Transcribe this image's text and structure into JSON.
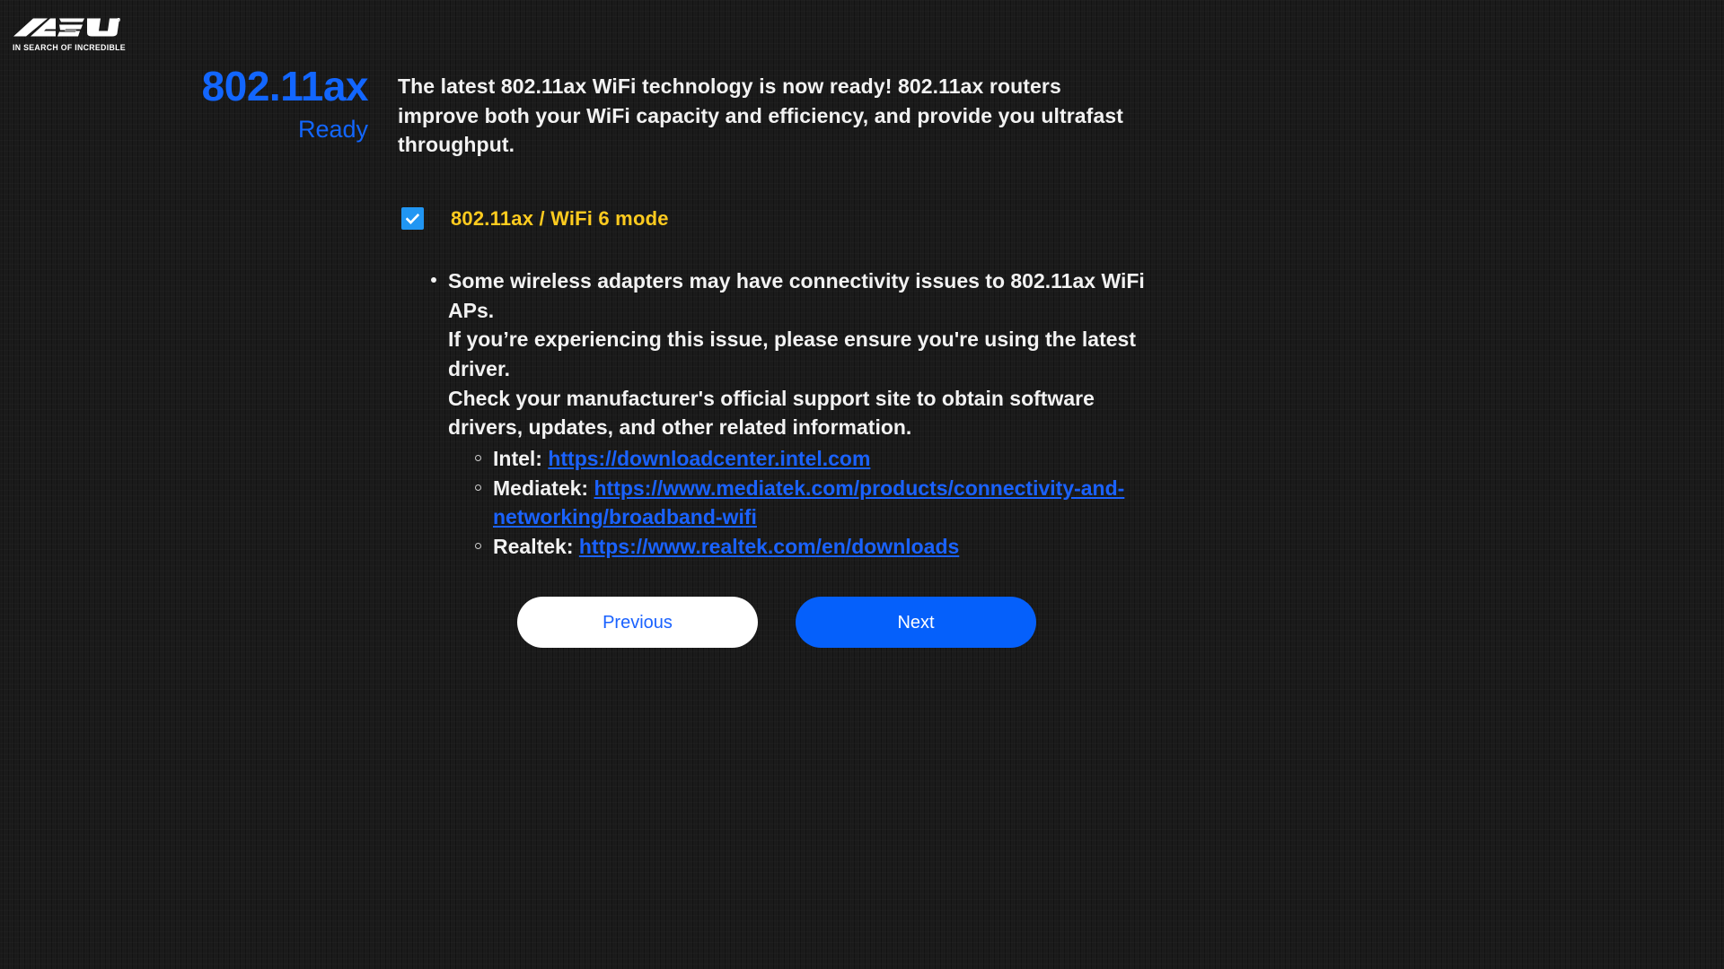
{
  "brand": {
    "logo_text": "ASUS",
    "tagline": "IN SEARCH OF INCREDIBLE"
  },
  "headline": {
    "title": "802.11ax",
    "status": "Ready"
  },
  "intro": {
    "paragraph": "The latest 802.11ax WiFi technology is now ready! 802.11ax routers improve both your WiFi capacity and efficiency, and provide you ultrafast throughput."
  },
  "mode_option": {
    "label": "802.11ax / WiFi 6 mode",
    "checked": true,
    "checkbox_icon": "check-icon"
  },
  "notes": {
    "bullet_lines": [
      "Some wireless adapters may have connectivity issues to 802.11ax WiFi APs.",
      "If you’re experiencing this issue, please ensure you're using the latest driver.",
      "Check your manufacturer's official support site to obtain software drivers, updates, and other related information."
    ],
    "vendor_links": [
      {
        "vendor": "Intel:",
        "url": "https://downloadcenter.intel.com"
      },
      {
        "vendor": "Mediatek:",
        "url": "https://www.mediatek.com/products/connectivity-and-networking/broadband-wifi"
      },
      {
        "vendor": "Realtek:",
        "url": "https://www.realtek.com/en/downloads"
      }
    ]
  },
  "buttons": {
    "previous": "Previous",
    "next": "Next"
  },
  "colors": {
    "background": "#1b1b1b",
    "accent_blue": "#0560fb",
    "headline_blue": "#1266ff",
    "link_blue": "#1a62ff",
    "mode_yellow": "#ffcb1f",
    "checkbox_blue": "#2196f3",
    "text": "#f2f2f2"
  }
}
